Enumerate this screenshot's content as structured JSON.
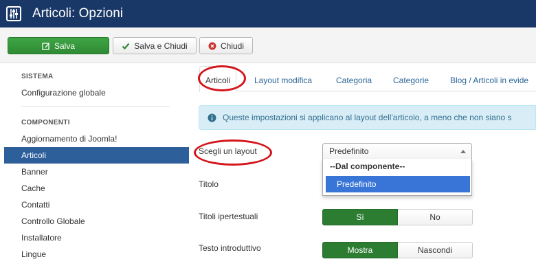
{
  "header": {
    "title": "Articoli: Opzioni",
    "logo_icon": "joomla-options-icon"
  },
  "toolbar": {
    "save_label": "Salva",
    "save_close_label": "Salva e Chiudi",
    "close_label": "Chiudi"
  },
  "sidebar": {
    "system_heading": "SISTEMA",
    "global_config": "Configurazione globale",
    "components_heading": "COMPONENTI",
    "items": [
      {
        "label": "Aggiornamento di Joomla!"
      },
      {
        "label": "Articoli",
        "active": true
      },
      {
        "label": "Banner"
      },
      {
        "label": "Cache"
      },
      {
        "label": "Contatti"
      },
      {
        "label": "Controllo Globale"
      },
      {
        "label": "Installatore"
      },
      {
        "label": "Lingue"
      }
    ]
  },
  "tabs": [
    {
      "label": "Articoli",
      "active": true
    },
    {
      "label": "Layout modifica"
    },
    {
      "label": "Categoria"
    },
    {
      "label": "Categorie"
    },
    {
      "label": "Blog / Articoli in evide"
    }
  ],
  "alert": {
    "text": "Queste impostazioni si applicano al layout dell'articolo, a meno che non siano s"
  },
  "fields": {
    "layout": {
      "label": "Scegli un layout",
      "value": "Predefinito",
      "dropdown_group": "--Dal componente--",
      "dropdown_option": "Predefinito"
    },
    "title": {
      "label": "Titolo"
    },
    "linked_titles": {
      "label": "Titoli ipertestuali",
      "on": "Sì",
      "off": "No",
      "selected": "Sì"
    },
    "intro_text": {
      "label": "Testo introduttivo",
      "on": "Mostra",
      "off": "Nascondi",
      "selected": "Mostra"
    }
  },
  "colors": {
    "header_bg": "#1a3867",
    "save_green": "#2f8a34",
    "sidebar_active": "#2d5f9a",
    "alert_bg": "#d9edf7",
    "dropdown_highlight": "#3875d7",
    "toggle_on": "#2c7d32",
    "annotation_ring": "#d4141b"
  }
}
